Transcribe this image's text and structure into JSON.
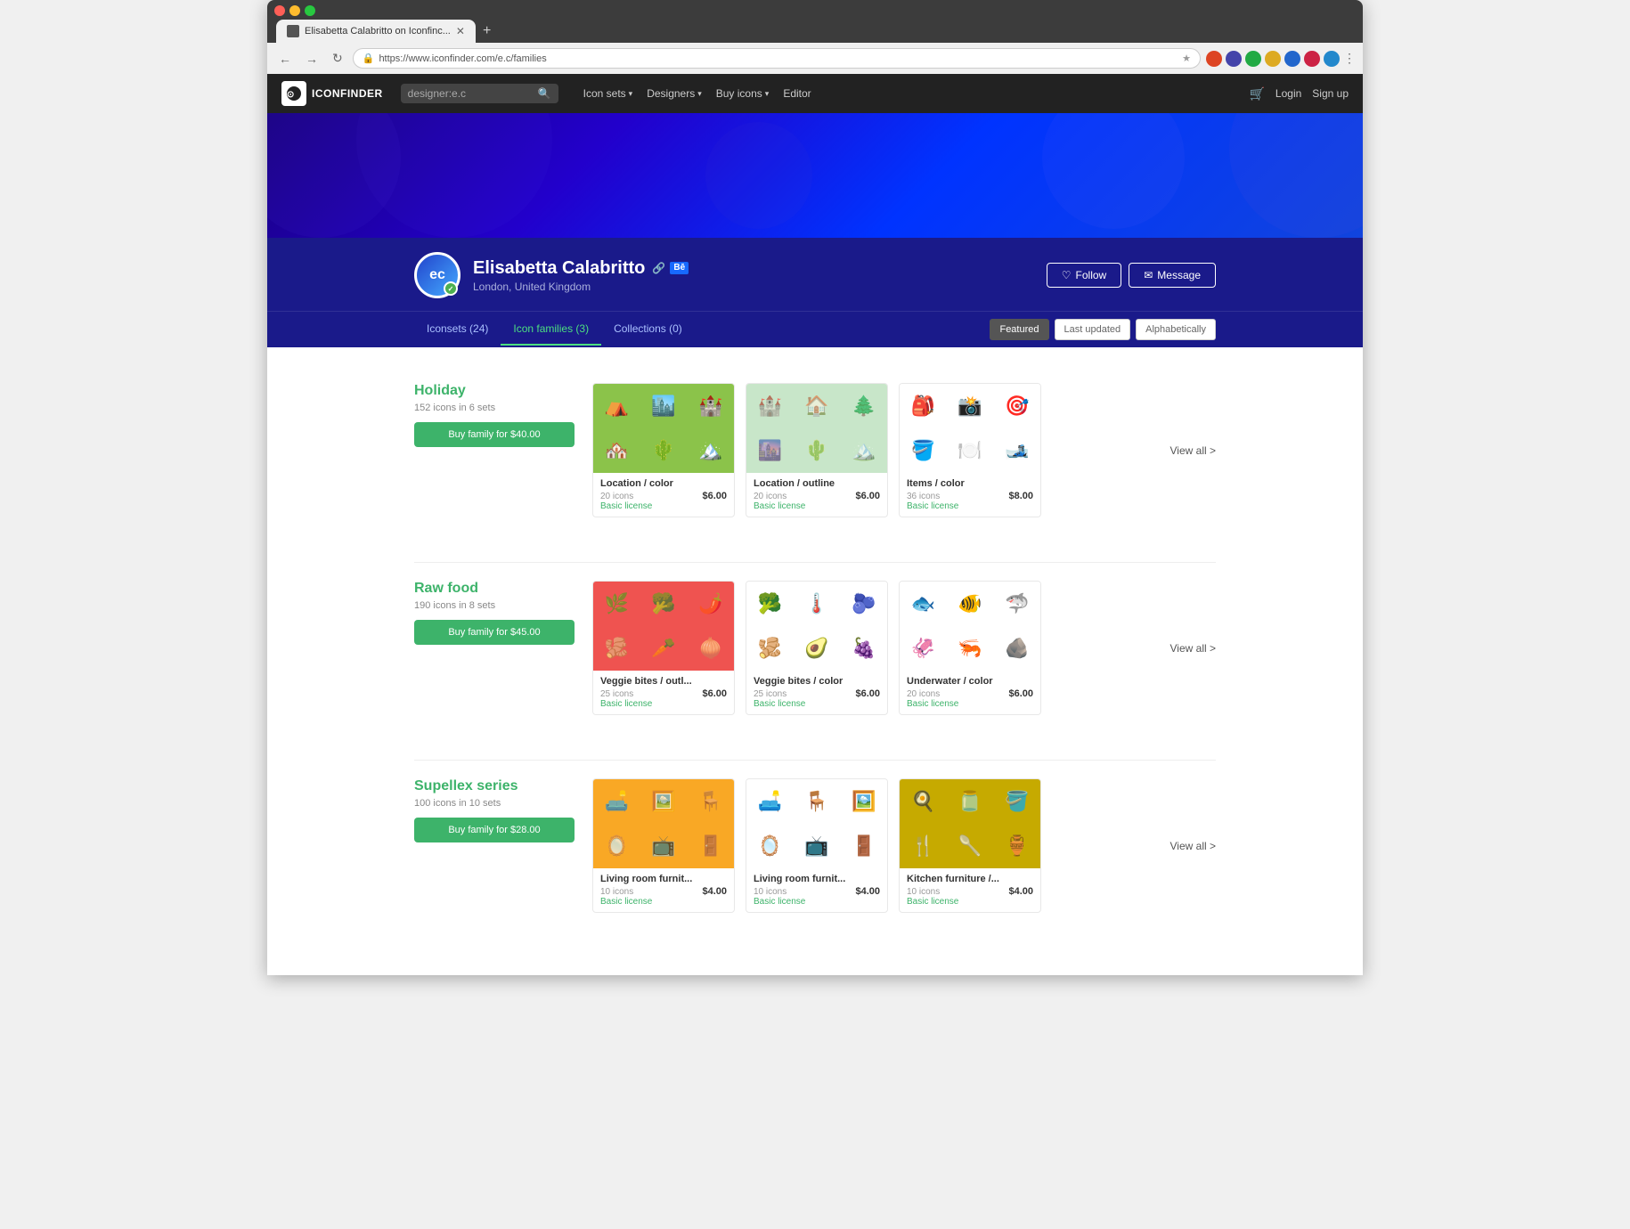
{
  "browser": {
    "tab_label": "Elisabetta Calabritto on Iconfinc...",
    "url": "https://www.iconfinder.com/e.c/families",
    "new_tab_label": "+"
  },
  "header": {
    "logo_text": "ICONFINDER",
    "search_placeholder": "designer:e.c",
    "nav_items": [
      {
        "label": "Icon sets",
        "has_dropdown": true
      },
      {
        "label": "Designers",
        "has_dropdown": true
      },
      {
        "label": "Buy icons",
        "has_dropdown": true
      },
      {
        "label": "Editor",
        "has_dropdown": false
      }
    ],
    "login_label": "Login",
    "signup_label": "Sign up"
  },
  "profile": {
    "initials": "ec",
    "name": "Elisabetta Calabritto",
    "location": "London, United Kingdom",
    "verified": true,
    "follow_label": "Follow",
    "message_label": "Message"
  },
  "tabs": {
    "items": [
      {
        "label": "Iconsets (24)",
        "active": false
      },
      {
        "label": "Icon families (3)",
        "active": true
      },
      {
        "label": "Collections (0)",
        "active": false
      }
    ],
    "sort_options": [
      {
        "label": "Featured",
        "active": true
      },
      {
        "label": "Last updated",
        "active": false
      },
      {
        "label": "Alphabetically",
        "active": false
      }
    ]
  },
  "families": [
    {
      "id": "holiday",
      "title": "Holiday",
      "meta": "152 icons in 6 sets",
      "buy_label": "Buy family for $40.00",
      "sets": [
        {
          "name": "Location / color",
          "count": "20 icons",
          "price": "$6.00",
          "license": "Basic license",
          "bg": "green",
          "icons": [
            "🏕️",
            "🏙️",
            "🏰",
            "🏘️",
            "🌵",
            "🏔️"
          ]
        },
        {
          "name": "Location / outline",
          "count": "20 icons",
          "price": "$6.00",
          "license": "Basic license",
          "bg": "outline-green",
          "icons": [
            "🏰",
            "🏠",
            "🌲",
            "🌆",
            "🌵",
            "🏔️"
          ]
        },
        {
          "name": "Items / color",
          "count": "36 icons",
          "price": "$8.00",
          "license": "Basic license",
          "bg": "white",
          "icons": [
            "🎒",
            "📸",
            "🎯",
            "🪣",
            "🍽️",
            "🎿"
          ]
        }
      ],
      "view_all_label": "View all >"
    },
    {
      "id": "rawfood",
      "title": "Raw food",
      "meta": "190 icons in 8 sets",
      "buy_label": "Buy family for $45.00",
      "sets": [
        {
          "name": "Veggie bites / outl...",
          "count": "25 icons",
          "price": "$6.00",
          "license": "Basic license",
          "bg": "red",
          "icons": [
            "🌿",
            "🥦",
            "🌶️",
            "🫚",
            "🥕",
            "🧅"
          ]
        },
        {
          "name": "Veggie bites / color",
          "count": "25 icons",
          "price": "$6.00",
          "license": "Basic license",
          "bg": "white",
          "icons": [
            "🥦",
            "🌡️",
            "🫐",
            "🫚",
            "🥑",
            "🍇"
          ]
        },
        {
          "name": "Underwater / color",
          "count": "20 icons",
          "price": "$6.00",
          "license": "Basic license",
          "bg": "white",
          "icons": [
            "🐟",
            "🐠",
            "🦈",
            "🦑",
            "🦐",
            "🪨"
          ]
        }
      ],
      "view_all_label": "View all >"
    },
    {
      "id": "supellex",
      "title": "Supellex series",
      "meta": "100 icons in 10 sets",
      "buy_label": "Buy family for $28.00",
      "sets": [
        {
          "name": "Living room furnit...",
          "count": "10 icons",
          "price": "$4.00",
          "license": "Basic license",
          "bg": "yellow",
          "icons": [
            "🛋️",
            "🖼️",
            "🪑",
            "🪞",
            "📺",
            "🚪"
          ]
        },
        {
          "name": "Living room furnit...",
          "count": "10 icons",
          "price": "$4.00",
          "license": "Basic license",
          "bg": "white",
          "icons": [
            "🛋️",
            "🪑",
            "🖼️",
            "🪞",
            "📺",
            "🚪"
          ]
        },
        {
          "name": "Kitchen furniture /...",
          "count": "10 icons",
          "price": "$4.00",
          "license": "Basic license",
          "bg": "olive",
          "icons": [
            "🍳",
            "🫙",
            "🪣",
            "🍴",
            "🥄",
            "🏺"
          ]
        }
      ],
      "view_all_label": "View all >"
    }
  ]
}
